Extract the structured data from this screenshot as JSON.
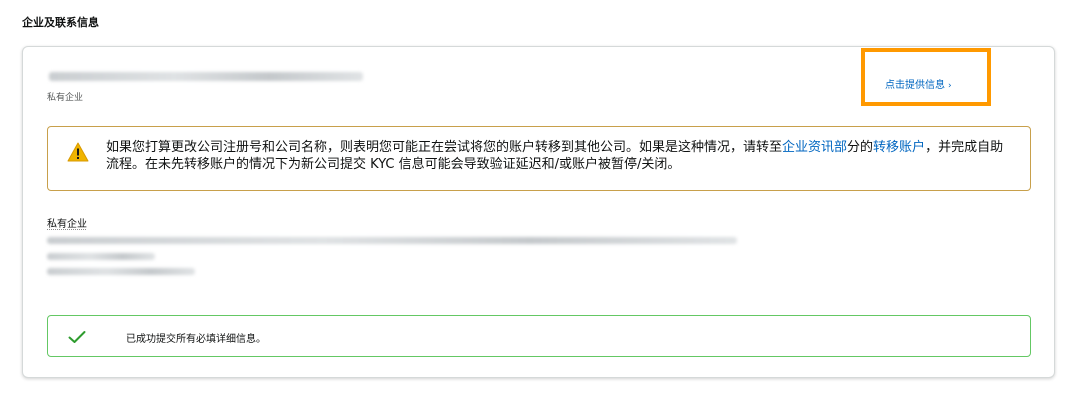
{
  "section": {
    "title": "企业及联系信息"
  },
  "card": {
    "business_type_top": "私有企业",
    "provide_link": "点击提供信息",
    "provide_link_icon": "chevron-right-icon",
    "warning": {
      "icon": "warning-icon",
      "text_before": "如果您打算更改公司注册号和公司名称，则表明您可能正在尝试将您的账户转移到其他公司。如果是这种情况，请转至",
      "link1": "企业资讯部",
      "text_middle": "分的",
      "link2": "转移账户",
      "text_after": "，并完成自助流程。在未先转移账户的情况下为新公司提交 KYC 信息可能会导致验证延迟和/或账户被暂停/关闭。",
      "border_color": "#c8a04b"
    },
    "business_type_mid": "私有企业",
    "success": {
      "icon": "checkmark-icon",
      "text": "已成功提交所有必填详细信息。",
      "border_color": "#64c864"
    }
  },
  "colors": {
    "link": "#0066c0",
    "highlight": "#ff9900"
  }
}
